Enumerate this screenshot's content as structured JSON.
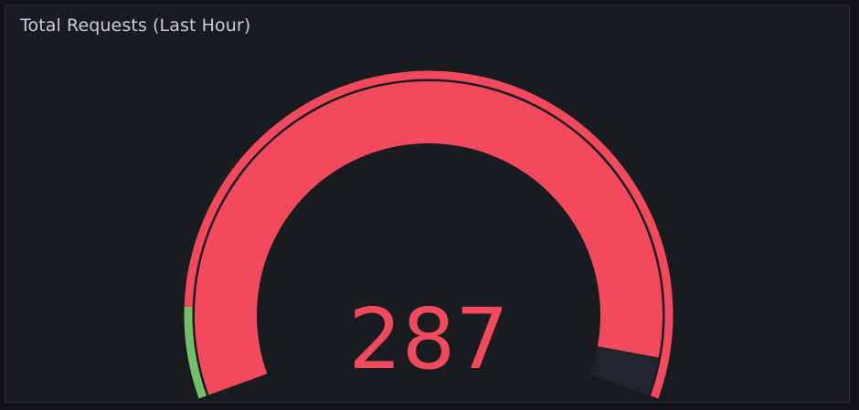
{
  "panel": {
    "title": "Total Requests (Last Hour)"
  },
  "gauge": {
    "value": 287,
    "display_value": "287",
    "min": 0,
    "max": 300,
    "thresholds": [
      {
        "value": 0,
        "color": "#73bf69"
      },
      {
        "value": 30,
        "color": "#f2495c"
      }
    ],
    "value_color": "#f2495c",
    "track_color": "#22252b"
  }
}
